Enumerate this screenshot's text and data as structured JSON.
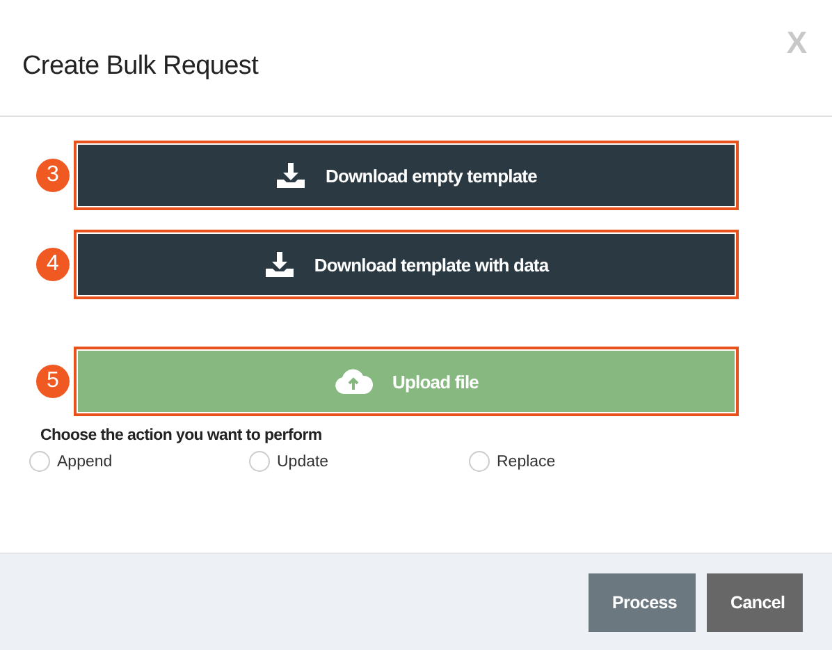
{
  "dialog": {
    "title": "Create Bulk Request",
    "close": "X"
  },
  "actions": [
    {
      "kind": "download",
      "marker": "3",
      "label": "Download empty template"
    },
    {
      "kind": "download",
      "marker": "4",
      "label": "Download template with data"
    },
    {
      "kind": "upload",
      "marker": "5",
      "label": "Upload file"
    }
  ],
  "choice": {
    "label": "Choose the action you want to perform",
    "options": [
      {
        "label": "Append",
        "selected": false
      },
      {
        "label": "Update",
        "selected": false
      },
      {
        "label": "Replace",
        "selected": false
      }
    ]
  },
  "footer": {
    "buttons": [
      {
        "kind": "primary",
        "label": "Process"
      },
      {
        "kind": "secondary",
        "label": "Cancel"
      }
    ]
  }
}
